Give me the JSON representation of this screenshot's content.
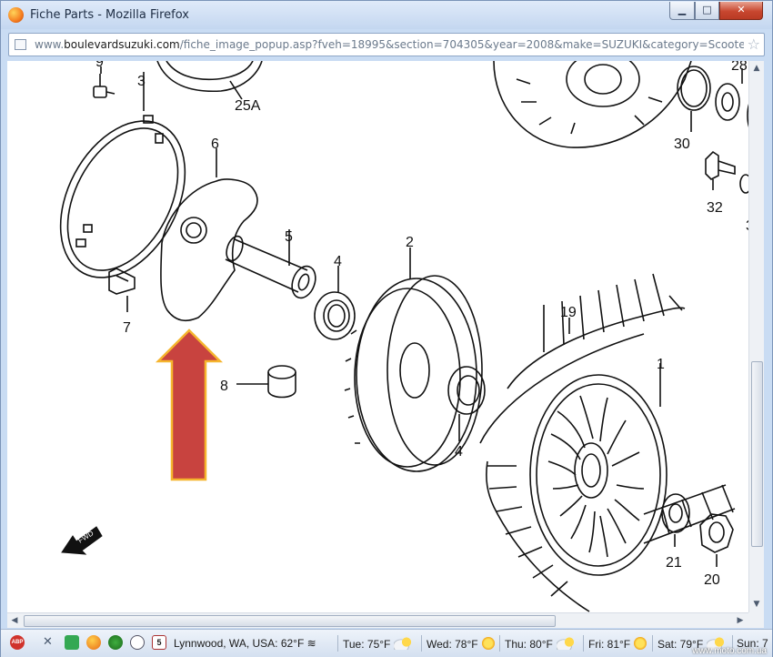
{
  "window": {
    "title": "Fiche Parts - Mozilla Firefox"
  },
  "address": {
    "url_prefix": "www.",
    "url_domain": "boulevardsuzuki.com",
    "url_path": "/fiche_image_popup.asp?fveh=18995&section=704305&year=2008&make=SUZUKI&category=Scooters&dc=27"
  },
  "diagram": {
    "part_labels": {
      "p9": "9",
      "p3": "3",
      "p25a": "25A",
      "p6": "6",
      "p5": "5",
      "p4a": "4",
      "p2": "2",
      "p7": "7",
      "p8": "8",
      "p19": "19",
      "p1": "1",
      "p4b": "4",
      "p21": "21",
      "p20": "20",
      "p28": "28",
      "p30": "30",
      "p32": "32",
      "p3b": "3"
    },
    "fwd_label": "FWD",
    "arrow_color": "#c8433f",
    "arrow_outline": "#f5b52e"
  },
  "statusbar": {
    "calendar_day": "5",
    "location": "Lynnwood, WA, USA: 62°F",
    "tue": "Tue: 75°F",
    "wed": "Wed: 78°F",
    "thu": "Thu: 80°F",
    "fri": "Fri: 81°F",
    "sat": "Sat: 79°F",
    "sun": "Sun: 7",
    "watermark": "www.moto.com.ua"
  }
}
